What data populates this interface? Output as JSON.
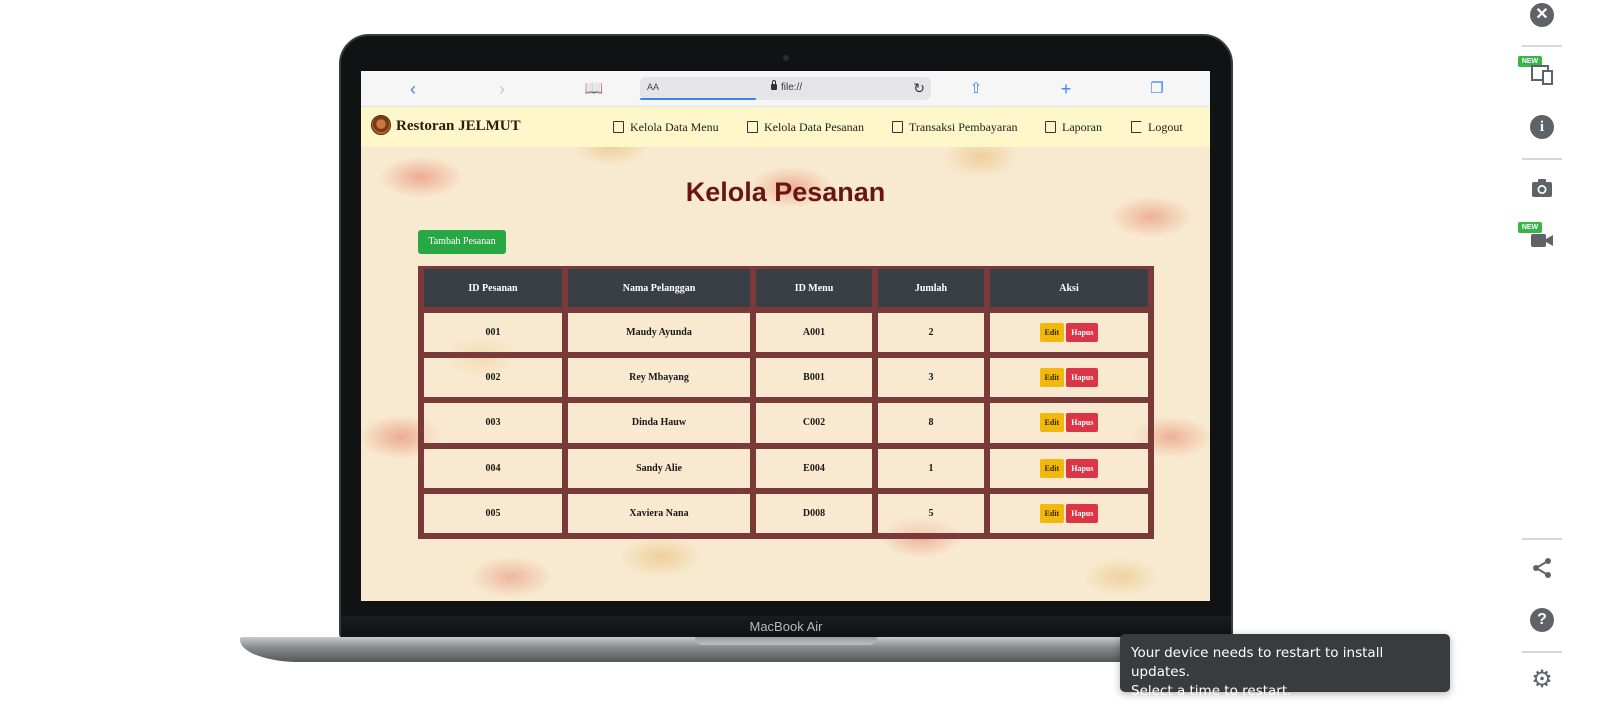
{
  "browser": {
    "url_placeholder": "AA",
    "url": "file://"
  },
  "laptop_label": "MacBook Air",
  "navbar": {
    "brand": "Restoran JELMUT",
    "items": [
      {
        "label": "Kelola Data Menu",
        "icon": "clipboard-icon"
      },
      {
        "label": "Kelola Data Pesanan",
        "icon": "receipt-icon"
      },
      {
        "label": "Transaksi Pembayaran",
        "icon": "payment-icon"
      },
      {
        "label": "Laporan",
        "icon": "report-icon"
      },
      {
        "label": "Logout",
        "icon": "logout-icon"
      }
    ]
  },
  "main": {
    "title": "Kelola Pesanan",
    "add_button": "Tambah Pesanan",
    "table": {
      "headers": [
        "ID Pesanan",
        "Nama Pelanggan",
        "ID Menu",
        "Jumlah",
        "Aksi"
      ],
      "rows": [
        {
          "id": "001",
          "nama": "Maudy Ayunda",
          "menu": "A001",
          "jumlah": "2"
        },
        {
          "id": "002",
          "nama": "Rey Mbayang",
          "menu": "B001",
          "jumlah": "3"
        },
        {
          "id": "003",
          "nama": "Dinda Hauw",
          "menu": "C002",
          "jumlah": "8"
        },
        {
          "id": "004",
          "nama": "Sandy Alie",
          "menu": "E004",
          "jumlah": "1"
        },
        {
          "id": "005",
          "nama": "Xaviera Nana",
          "menu": "D008",
          "jumlah": "5"
        }
      ],
      "edit_label": "Edit",
      "delete_label": "Hapus"
    }
  },
  "toolbar": {
    "new_badge": "NEW"
  },
  "notification": {
    "line1": "Your device needs to restart to install updates.",
    "line2": "Select a time to restart."
  },
  "colors": {
    "title": "#6b1513",
    "add_button": "#28a745",
    "edit_button": "#f2b80b",
    "delete_button": "#dc3545",
    "table_header": "#3a3f46",
    "table_border": "#7a3a3a",
    "navbar": "#fdf7c9"
  }
}
